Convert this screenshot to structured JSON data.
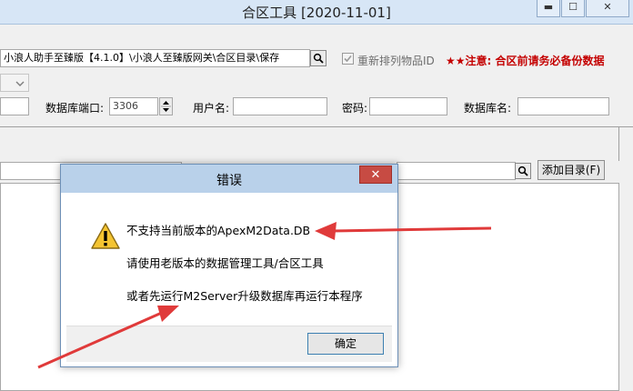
{
  "window": {
    "title": "合区工具 [2020-11-01]",
    "minimize": "▬",
    "maximize": "☐",
    "close": "✕"
  },
  "toolbar": {
    "path_value": "小浪人助手至臻版【4.1.0】\\小浪人至臻版网关\\合区目录\\保存",
    "reorder_label": "重新排列物品ID",
    "reorder_checked": true,
    "notice": "★★注意: 合区前请务必备份数据"
  },
  "db": {
    "port_label": "数据库端口:",
    "port_value": "3306",
    "user_label": "用户名:",
    "password_label": "密码:",
    "dbname_label": "数据库名:"
  },
  "list_area": {
    "add_dir_button": "添加目录(F)"
  },
  "dialog": {
    "title": "错误",
    "close": "✕",
    "line1": "不支持当前版本的ApexM2Data.DB",
    "line2": "请使用老版本的数据管理工具/合区工具",
    "line3": "或者先运行M2Server升级数据库再运行本程序",
    "ok_button": "确定"
  }
}
